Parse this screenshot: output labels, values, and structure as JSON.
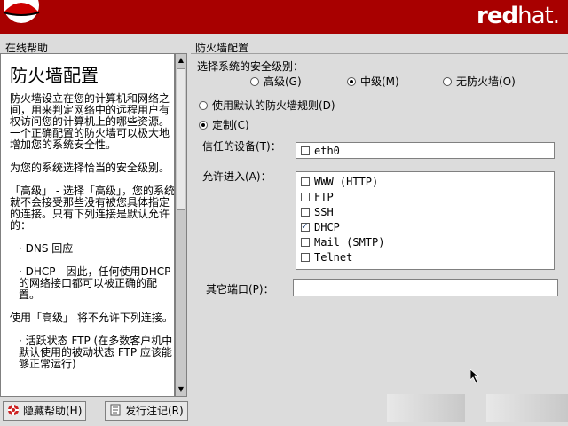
{
  "brand": {
    "red": "red",
    "hat": "hat."
  },
  "help": {
    "section_label": "在线帮助",
    "title": "防火墙配置",
    "paragraphs": [
      "防火墙设立在您的计算机和网络之间，用来判定网络中的远程用户有权访问您的计算机上的哪些资源。一个正确配置的防火墙可以极大地增加您的系统安全性。",
      "为您的系统选择恰当的安全级别。",
      "「高级」 - 选择「高级」，您的系统就不会接受那些没有被您具体指定的连接。只有下列连接是默认允许的：",
      "· DNS 回应",
      "· DHCP - 因此，任何使用DHCP 的网络接口都可以被正确的配置。",
      "使用「高级」 将不允许下列连接。",
      "· 活跃状态 FTP (在多数客户机中默认使用的被动状态 FTP 应该能够正常运行)"
    ]
  },
  "firewall": {
    "frame_title": "防火墙配置",
    "security_level_label": "选择系统的安全级别：",
    "levels": [
      {
        "label": "高级(G)",
        "selected": false
      },
      {
        "label": "中级(M)",
        "selected": true
      },
      {
        "label": "无防火墙(O)",
        "selected": false
      }
    ],
    "rule_options": [
      {
        "label": "使用默认的防火墙规则(D)",
        "selected": false
      },
      {
        "label": "定制(C)",
        "selected": true
      }
    ],
    "trusted_label": "信任的设备(T)：",
    "trusted_devices": [
      {
        "name": "eth0",
        "checked": false
      }
    ],
    "allow_label": "允许进入(A)：",
    "allow_services": [
      {
        "name": "WWW (HTTP)",
        "checked": false
      },
      {
        "name": "FTP",
        "checked": false
      },
      {
        "name": "SSH",
        "checked": false
      },
      {
        "name": "DHCP",
        "checked": true
      },
      {
        "name": "Mail (SMTP)",
        "checked": false
      },
      {
        "name": "Telnet",
        "checked": false
      }
    ],
    "other_ports_label": "其它端口(P)：",
    "other_ports_value": ""
  },
  "bottom": {
    "hide_help_label": "隐藏帮助(H)",
    "release_notes_label": "发行注记(R)"
  }
}
